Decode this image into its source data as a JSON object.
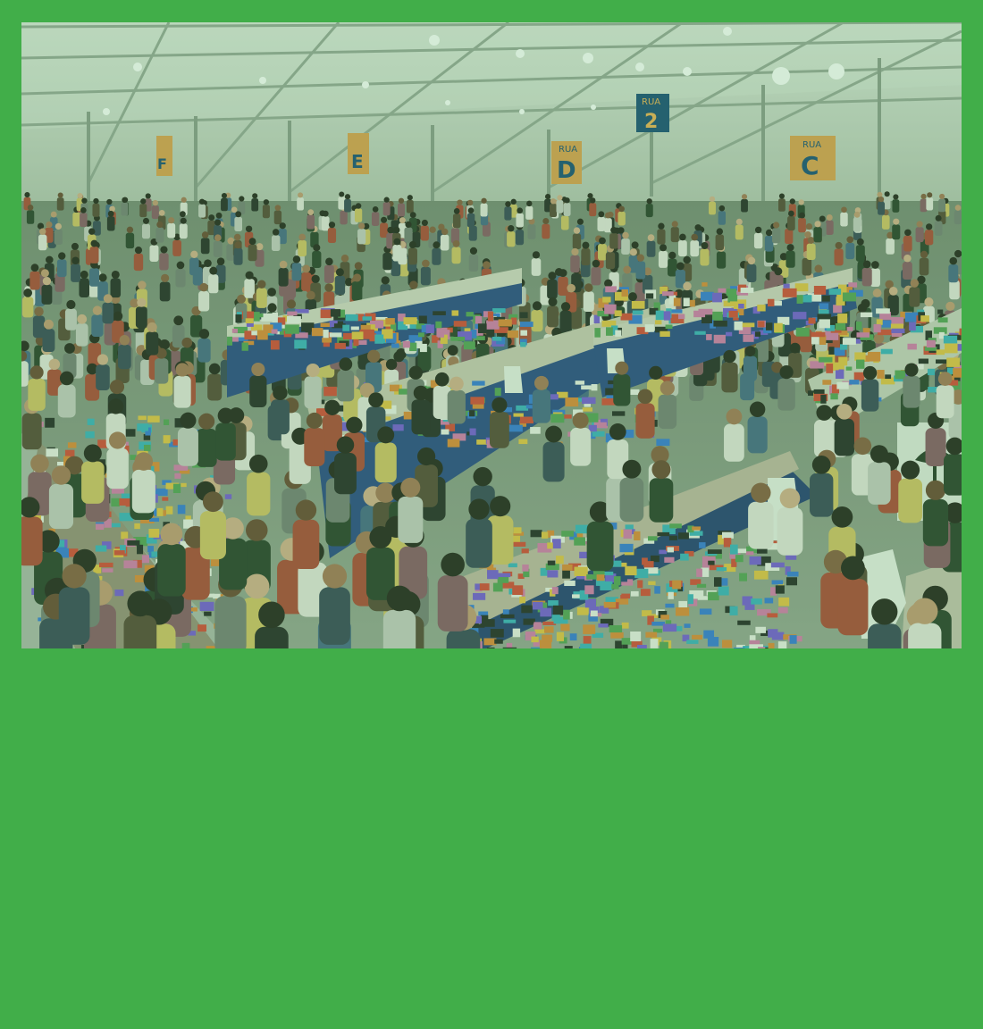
{
  "background_color": "#41ae49",
  "photo": {
    "subject": "book-fair-exhibition-hall",
    "tint_color": "#3aa64a",
    "signs": [
      {
        "rua": "",
        "letter": "F"
      },
      {
        "rua": "",
        "letter": "E"
      },
      {
        "rua": "RUA",
        "letter": "D"
      },
      {
        "rua": "RUA",
        "letter": "2"
      },
      {
        "rua": "RUA",
        "letter": "C"
      }
    ]
  }
}
